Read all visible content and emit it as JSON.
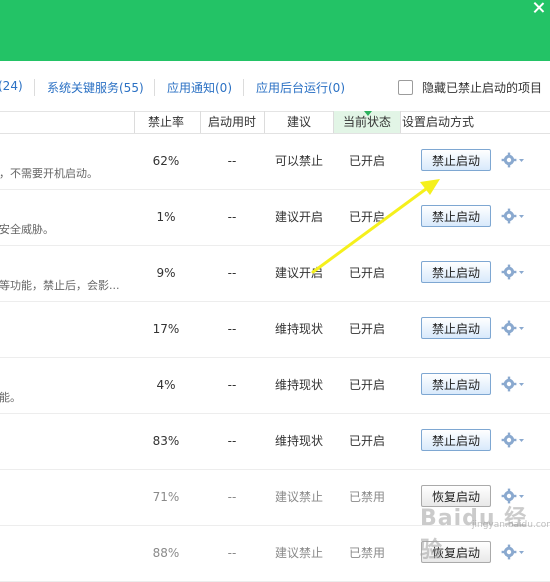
{
  "tabs": [
    {
      "label": "(24)"
    },
    {
      "label": "系统关键服务(55)"
    },
    {
      "label": "应用通知(0)"
    },
    {
      "label": "应用后台运行(0)"
    }
  ],
  "hide_disabled_label": "隐藏已禁止启动的项目",
  "columns": {
    "rate": "禁止率",
    "time": "启动用时",
    "suggestion": "建议",
    "state": "当前状态",
    "action": "设置启动方式"
  },
  "rows": [
    {
      "desc": "，不需要开机启动。",
      "rate": "62%",
      "time": "--",
      "suggestion": "可以禁止",
      "state": "已开启",
      "button": "禁止启动",
      "dim": false
    },
    {
      "desc": "安全威胁。",
      "rate": "1%",
      "time": "--",
      "suggestion": "建议开启",
      "state": "已开启",
      "button": "禁止启动",
      "dim": false
    },
    {
      "desc": "等功能，禁止后，会影...",
      "rate": "9%",
      "time": "--",
      "suggestion": "建议开启",
      "state": "已开启",
      "button": "禁止启动",
      "dim": false
    },
    {
      "desc": "",
      "rate": "17%",
      "time": "--",
      "suggestion": "维持现状",
      "state": "已开启",
      "button": "禁止启动",
      "dim": false
    },
    {
      "desc": "能。",
      "rate": "4%",
      "time": "--",
      "suggestion": "维持现状",
      "state": "已开启",
      "button": "禁止启动",
      "dim": false
    },
    {
      "desc": "",
      "rate": "83%",
      "time": "--",
      "suggestion": "维持现状",
      "state": "已开启",
      "button": "禁止启动",
      "dim": false
    },
    {
      "desc": "",
      "rate": "71%",
      "time": "--",
      "suggestion": "建议禁止",
      "state": "已禁用",
      "button": "恢复启动",
      "dim": true
    },
    {
      "desc": "",
      "rate": "88%",
      "time": "--",
      "suggestion": "建议禁止",
      "state": "已禁用",
      "button": "恢复启动",
      "dim": true
    }
  ],
  "watermark": {
    "text": "Baidu 经验",
    "sub": "jingyan.baidu.com"
  },
  "colors": {
    "banner": "#23c366",
    "link": "#2b71c4",
    "annotation_arrow": "#f5f01c"
  }
}
